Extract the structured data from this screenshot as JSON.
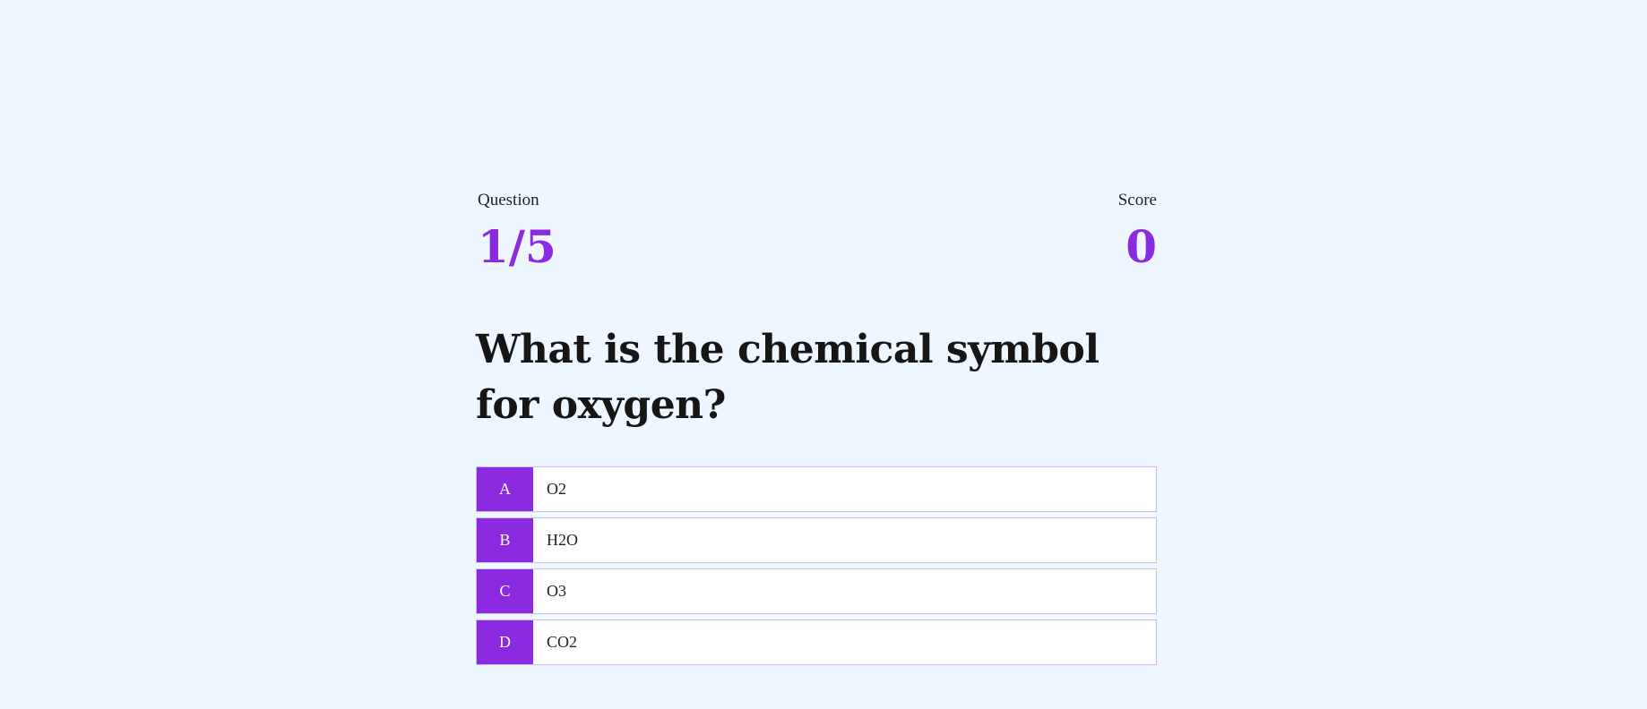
{
  "quiz": {
    "question_label": "Question",
    "question_progress": "1/5",
    "score_label": "Score",
    "score_value": "0",
    "question_text": "What is the chemical symbol for oxygen?",
    "answers": [
      {
        "letter": "A",
        "text": "O2"
      },
      {
        "letter": "B",
        "text": "H2O"
      },
      {
        "letter": "C",
        "text": "O3"
      },
      {
        "letter": "D",
        "text": "CO2"
      }
    ]
  },
  "colors": {
    "background": "#eef6ff",
    "accent": "#8a2be2",
    "answer_border": "#c9c0ea"
  }
}
